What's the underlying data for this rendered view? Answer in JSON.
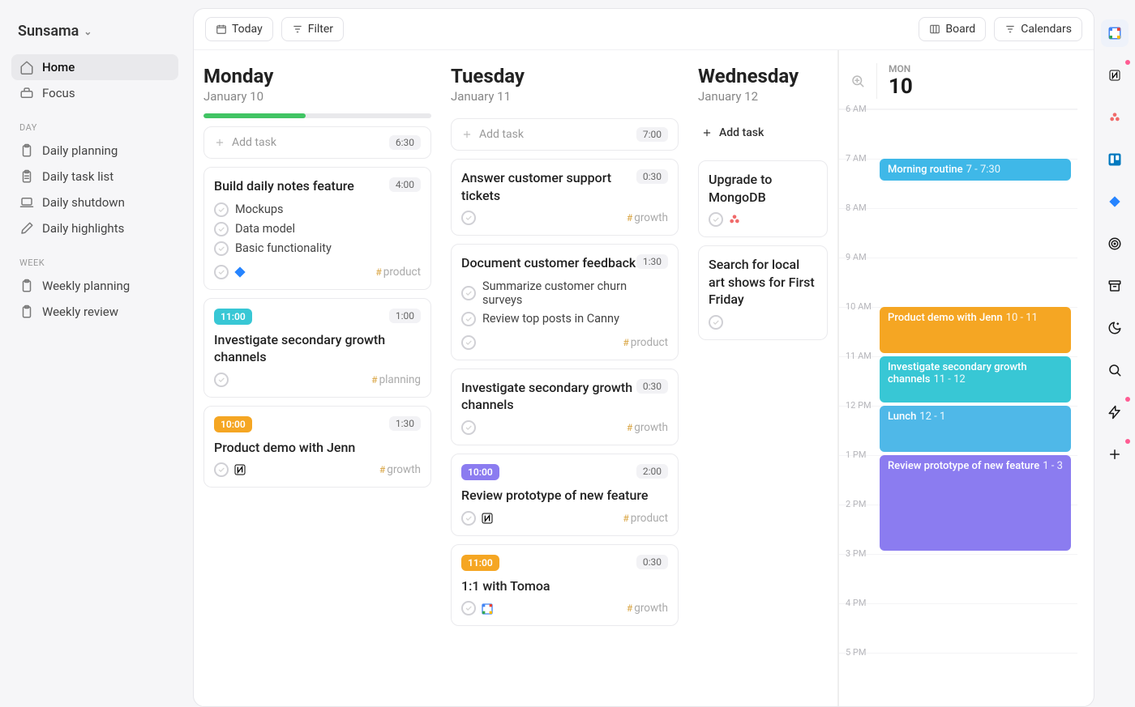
{
  "workspace": {
    "name": "Sunsama"
  },
  "nav": {
    "main": [
      {
        "label": "Home",
        "icon": "home",
        "active": true
      },
      {
        "label": "Focus",
        "icon": "focus",
        "active": false
      }
    ],
    "sections": [
      {
        "title": "DAY",
        "items": [
          {
            "label": "Daily planning",
            "icon": "clipboard"
          },
          {
            "label": "Daily task list",
            "icon": "checklist"
          },
          {
            "label": "Daily shutdown",
            "icon": "laptop"
          },
          {
            "label": "Daily highlights",
            "icon": "pen"
          }
        ]
      },
      {
        "title": "WEEK",
        "items": [
          {
            "label": "Weekly planning",
            "icon": "clipboard"
          },
          {
            "label": "Weekly review",
            "icon": "clipboard"
          }
        ]
      }
    ]
  },
  "toolbar": {
    "today": "Today",
    "filter": "Filter",
    "board": "Board",
    "calendars": "Calendars"
  },
  "days": [
    {
      "name": "Monday",
      "date": "January 10",
      "progress": 45,
      "addTask": {
        "label": "Add task",
        "duration": "6:30",
        "boxed": true
      },
      "cards": [
        {
          "title": "Build daily notes feature",
          "duration": "4:00",
          "subtasks": [
            "Mockups",
            "Data model",
            "Basic functionality"
          ],
          "integration": "jira",
          "channel": "product"
        },
        {
          "time": "11:00",
          "timeColor": "#38c7d5",
          "duration": "1:00",
          "title": "Investigate secondary growth channels",
          "channel": "planning"
        },
        {
          "time": "10:00",
          "timeColor": "#f5a623",
          "duration": "1:30",
          "title": "Product demo with Jenn",
          "integration": "notion",
          "channel": "growth"
        }
      ]
    },
    {
      "name": "Tuesday",
      "date": "January 11",
      "addTask": {
        "label": "Add task",
        "duration": "7:00",
        "boxed": true
      },
      "cards": [
        {
          "title": "Answer customer support tickets",
          "duration": "0:30",
          "channel": "growth"
        },
        {
          "title": "Document customer feedback",
          "duration": "1:30",
          "subtasks": [
            "Summarize customer churn surveys",
            "Review top posts in Canny"
          ],
          "channel": "product"
        },
        {
          "title": "Investigate secondary growth channels",
          "duration": "0:30",
          "channel": "growth"
        },
        {
          "time": "10:00",
          "timeColor": "#8b7cf0",
          "duration": "2:00",
          "title": "Review prototype of new feature",
          "integration": "notion",
          "channel": "product"
        },
        {
          "time": "11:00",
          "timeColor": "#f5a623",
          "duration": "0:30",
          "title": "1:1 with Tomoa",
          "integration": "gcal",
          "channel": "growth"
        }
      ]
    },
    {
      "name": "Wednesday",
      "date": "January 12",
      "addTask": {
        "label": "Add task",
        "boxed": false
      },
      "cards": [
        {
          "title": "Upgrade to MongoDB",
          "integration": "asana"
        },
        {
          "title": "Search for local art shows for First Friday"
        }
      ]
    }
  ],
  "calendar": {
    "dow": "MON",
    "day": "10",
    "hours": [
      "6 AM",
      "7 AM",
      "8 AM",
      "9 AM",
      "10 AM",
      "11 AM",
      "12 PM",
      "1 PM",
      "2 PM",
      "3 PM",
      "4 PM",
      "5 PM"
    ],
    "events": [
      {
        "title": "Morning routine",
        "time": "7 - 7:30",
        "color": "#3fb8e8",
        "startHour": 7,
        "durHours": 0.5
      },
      {
        "title": "Product demo with Jenn",
        "time": "10 - 11",
        "color": "#f5a623",
        "startHour": 10,
        "durHours": 1
      },
      {
        "title": "Investigate secondary growth channels",
        "time": "11 - 12",
        "color": "#38c7d5",
        "startHour": 11,
        "durHours": 1
      },
      {
        "title": "Lunch",
        "time": "12 - 1",
        "color": "#4fb8e8",
        "startHour": 12,
        "durHours": 1
      },
      {
        "title": "Review prototype of new feature",
        "time": "1 - 3",
        "color": "#8b7cf0",
        "startHour": 13,
        "durHours": 2
      }
    ]
  },
  "rail": [
    {
      "name": "gcal",
      "active": true
    },
    {
      "name": "notion",
      "dot": true
    },
    {
      "name": "asana"
    },
    {
      "name": "trello"
    },
    {
      "name": "jira"
    },
    {
      "name": "target"
    },
    {
      "name": "archive"
    },
    {
      "name": "moon"
    },
    {
      "name": "search"
    },
    {
      "name": "zap",
      "dot": true
    },
    {
      "name": "plus",
      "dot": true
    }
  ]
}
